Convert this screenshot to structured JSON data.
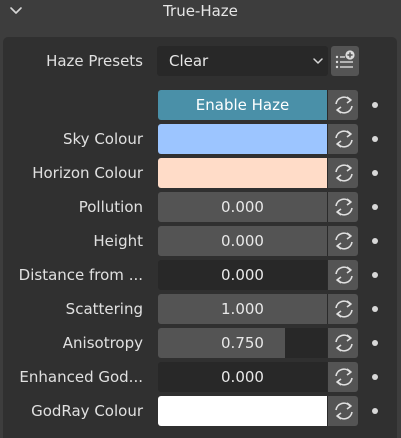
{
  "panel": {
    "title": "True-Haze"
  },
  "presets": {
    "label": "Haze Presets",
    "selected": "Clear"
  },
  "enable_haze": {
    "label": "Enable Haze"
  },
  "properties": [
    {
      "label": "Sky Colour",
      "type": "color",
      "color": "#9cc5ff"
    },
    {
      "label": "Horizon Colour",
      "type": "color",
      "color": "#ffdcc8"
    },
    {
      "label": "Pollution",
      "type": "number",
      "value": "0.000"
    },
    {
      "label": "Height",
      "type": "number",
      "value": "0.000"
    },
    {
      "label": "Distance from ...",
      "type": "number",
      "value": "0.000",
      "fill_fraction": 0
    },
    {
      "label": "Scattering",
      "type": "number",
      "value": "1.000"
    },
    {
      "label": "Anisotropy",
      "type": "number",
      "value": "0.750",
      "fill_fraction": 0.75
    },
    {
      "label": "Enhanced God...",
      "type": "number",
      "value": "0.000",
      "fill_fraction": 0
    },
    {
      "label": "GodRay Colour",
      "type": "color",
      "color": "#ffffff"
    }
  ],
  "colors": {
    "accent": "#4a90a8",
    "field": "#545454",
    "field_dark": "#282828",
    "panel_bg": "#303030"
  },
  "icons": {
    "header": "chevron-down-icon",
    "select": "chevron-down-icon",
    "preset_add": "preset-add-icon",
    "keyframe": "keyframe-cycle-icon",
    "anim_indicator": "anim-dot-icon"
  }
}
